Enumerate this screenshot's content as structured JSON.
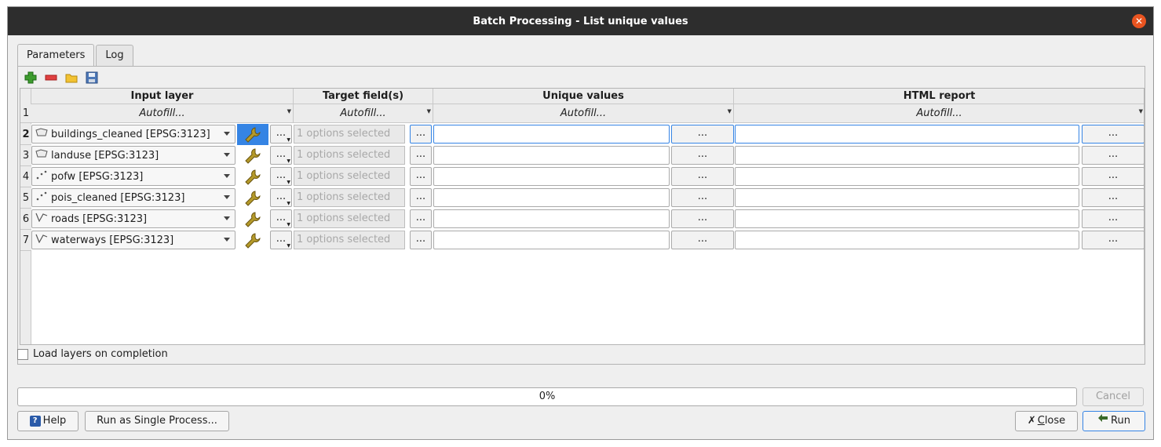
{
  "window": {
    "title": "Batch Processing - List unique values"
  },
  "tabs": [
    {
      "label": "Parameters"
    },
    {
      "label": "Log"
    }
  ],
  "toolbar": {
    "icons": [
      "add-row-icon",
      "remove-row-icon",
      "open-folder-icon",
      "save-icon"
    ]
  },
  "columns": {
    "input_layer": "Input layer",
    "target_fields": "Target field(s)",
    "unique_values": "Unique values",
    "html_report": "HTML report"
  },
  "autofill": {
    "label": "Autofill...",
    "row_number": "1"
  },
  "rows": [
    {
      "num": "2",
      "layer": "buildings_cleaned [EPSG:3123]",
      "geom": "polygon",
      "fields": "1 options selected",
      "dots": "...",
      "selected": true
    },
    {
      "num": "3",
      "layer": "landuse [EPSG:3123]",
      "geom": "polygon",
      "fields": "1 options selected",
      "dots": "..."
    },
    {
      "num": "4",
      "layer": "pofw [EPSG:3123]",
      "geom": "point",
      "fields": "1 options selected",
      "dots": "..."
    },
    {
      "num": "5",
      "layer": "pois_cleaned [EPSG:3123]",
      "geom": "point",
      "fields": "1 options selected",
      "dots": "..."
    },
    {
      "num": "6",
      "layer": "roads [EPSG:3123]",
      "geom": "line",
      "fields": "1 options selected",
      "dots": "..."
    },
    {
      "num": "7",
      "layer": "waterways [EPSG:3123]",
      "geom": "line",
      "fields": "1 options selected",
      "dots": "..."
    }
  ],
  "load_layers": {
    "label": "Load layers on completion",
    "checked": false
  },
  "progress": {
    "text": "0%",
    "value": 0
  },
  "buttons": {
    "cancel": "Cancel",
    "help": "Help",
    "help_icon": "?",
    "single": "Run as Single Process...",
    "close_prefix": "C",
    "close_rest": "lose",
    "run": "Run"
  }
}
